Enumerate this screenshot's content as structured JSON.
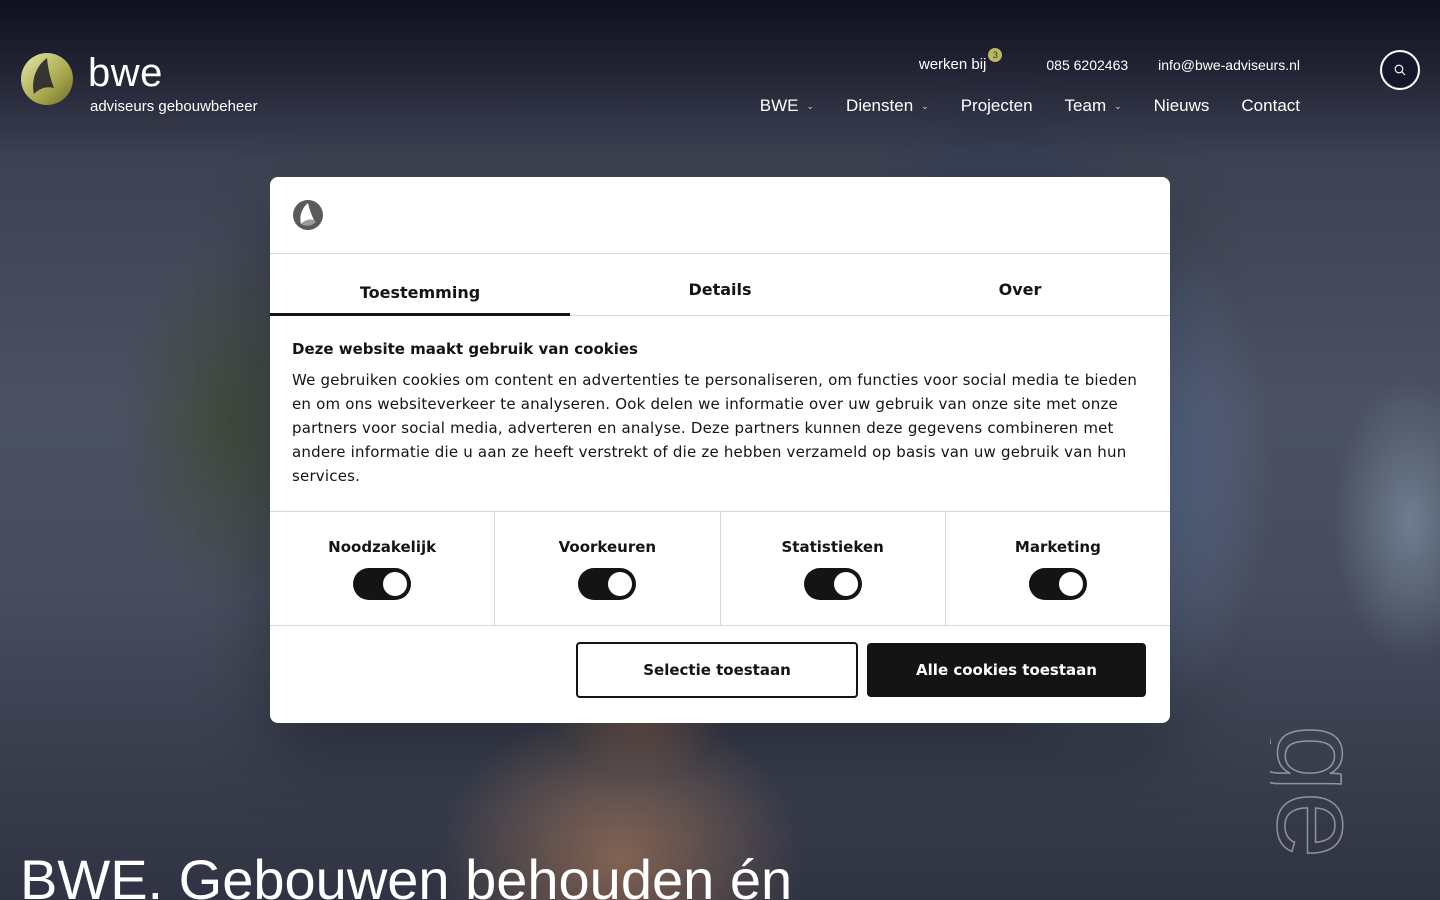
{
  "brand": {
    "name": "bwe",
    "tagline": "adviseurs gebouwbeheer"
  },
  "topbar": {
    "werken_bij": "werken bij",
    "werken_bij_badge": "3",
    "phone": "085 6202463",
    "email": "info@bwe-adviseurs.nl"
  },
  "nav": {
    "items": [
      {
        "label": "BWE",
        "has_dropdown": true
      },
      {
        "label": "Diensten",
        "has_dropdown": true
      },
      {
        "label": "Projecten",
        "has_dropdown": false
      },
      {
        "label": "Team",
        "has_dropdown": true
      },
      {
        "label": "Nieuws",
        "has_dropdown": false
      },
      {
        "label": "Contact",
        "has_dropdown": false
      }
    ],
    "search_icon": "search-icon"
  },
  "hero": {
    "title": "BWE. Gebouwen behouden én",
    "vertical_text": "ge"
  },
  "cookie_dialog": {
    "tabs": [
      {
        "label": "Toestemming",
        "active": true
      },
      {
        "label": "Details",
        "active": false
      },
      {
        "label": "Over",
        "active": false
      }
    ],
    "title": "Deze website maakt gebruik van cookies",
    "text": "We gebruiken cookies om content en advertenties te personaliseren, om functies voor social media te bieden en om ons websiteverkeer te analyseren. Ook delen we informatie over uw gebruik van onze site met onze partners voor social media, adverteren en analyse. Deze partners kunnen deze gegevens combineren met andere informatie die u aan ze heeft verstrekt of die ze hebben verzameld op basis van uw gebruik van hun services.",
    "toggles": [
      {
        "label": "Noodzakelijk",
        "checked": true
      },
      {
        "label": "Voorkeuren",
        "checked": true
      },
      {
        "label": "Statistieken",
        "checked": true
      },
      {
        "label": "Marketing",
        "checked": true
      }
    ],
    "buttons": {
      "selection": "Selectie toestaan",
      "allow_all": "Alle cookies toestaan"
    }
  },
  "colors": {
    "header_bg": "#0e0e1e",
    "brand_accent": "#b9b85e",
    "dialog_dark": "#141414"
  }
}
